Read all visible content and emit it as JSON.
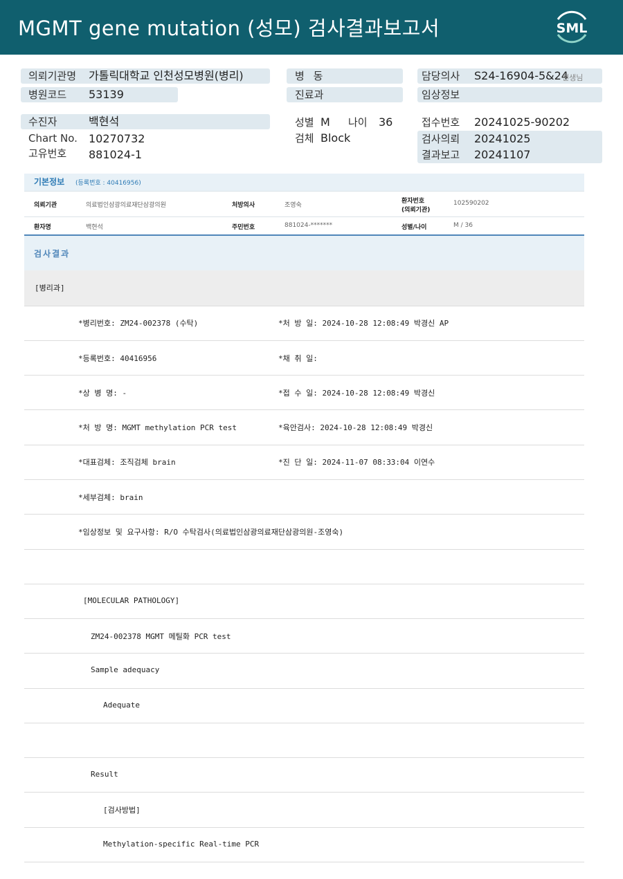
{
  "header": {
    "title": "MGMT gene mutation (성모) 검사결과보고서",
    "logo_text": "SML",
    "bg_color": "#105f6e"
  },
  "top": {
    "request_org_label": "의뢰기관명",
    "request_org_value": "가톨릭대학교 인천성모병원(병리)",
    "hospital_code_label": "병원코드",
    "hospital_code_value": "53139",
    "ward_label": "병 동",
    "dept_label": "진료과",
    "doctor_label": "담당의사",
    "doctor_value": "S24-16904-5&24",
    "doctor_suffix": "선생님",
    "clinical_label": "임상정보",
    "patient_label": "수진자",
    "patient_value": "백현석",
    "chart_label": "Chart No.",
    "chart_value": "10270732",
    "uid_label": "고유번호",
    "uid_value": "881024-1",
    "sex_label": "성별",
    "sex_value": "M",
    "age_label": "나이",
    "age_value": "36",
    "specimen_label": "검체",
    "specimen_value": "Block",
    "receipt_label": "접수번호",
    "receipt_value": "20241025-90202",
    "test_request_label": "검사의뢰",
    "test_request_value": "20241025",
    "report_label": "결과보고",
    "report_value": "20241107"
  },
  "basic": {
    "title": "기본정보",
    "reg_text": "(등록번호 : 40416956)",
    "org_label": "의뢰기관",
    "org_value": "의료법인삼광의료재단삼광의원",
    "presc_doc_label": "처방의사",
    "presc_doc_value": "조영숙",
    "patient_no_label_1": "환자번호",
    "patient_no_label_2": "(의뢰기관)",
    "patient_no_value": "102590202",
    "patient_name_label": "환자명",
    "patient_name_value": "백현석",
    "rrn_label": "주민번호",
    "rrn_value": "881024-*******",
    "sex_age_label": "성별/나이",
    "sex_age_value": "M / 36"
  },
  "result": {
    "title": "검사결과",
    "dept": "[병리과]",
    "pathology_no": "*병리번호: ZM24-002378 (수탁)",
    "order_date": "*처 방 일: 2024-10-28 12:08:49  박경신 AP",
    "reg_no": "*등록번호: 40416956",
    "collect_date": "*채 취 일:",
    "diagnosis": "*상 병 명: -",
    "receipt_date": "*접 수 일: 2024-10-28 12:08:49  박경신",
    "order_name": "*처 방 명: MGMT methylation  PCR test",
    "gross_exam": "*육안검사: 2024-10-28 12:08:49  박경신",
    "main_specimen": "*대표검체: 조직검체 brain",
    "diag_date": "*진 단 일: 2024-11-07 08:33:04  이연수",
    "sub_specimen": "*세부검체: brain",
    "clinical_info": "*임상정보 및 요구사항: R/O 수탁검사(의료법인삼광의료재단삼광의원-조영숙)",
    "mol_header": "[MOLECULAR PATHOLOGY]",
    "mol_test": "ZM24-002378     MGMT 메틸화  PCR test",
    "adequacy_label": "Sample adequacy",
    "adequacy_value": "Adequate",
    "result_label": "Result",
    "method_label": "[검사방법]",
    "method_value": "Methylation-specific Real-time PCR"
  }
}
